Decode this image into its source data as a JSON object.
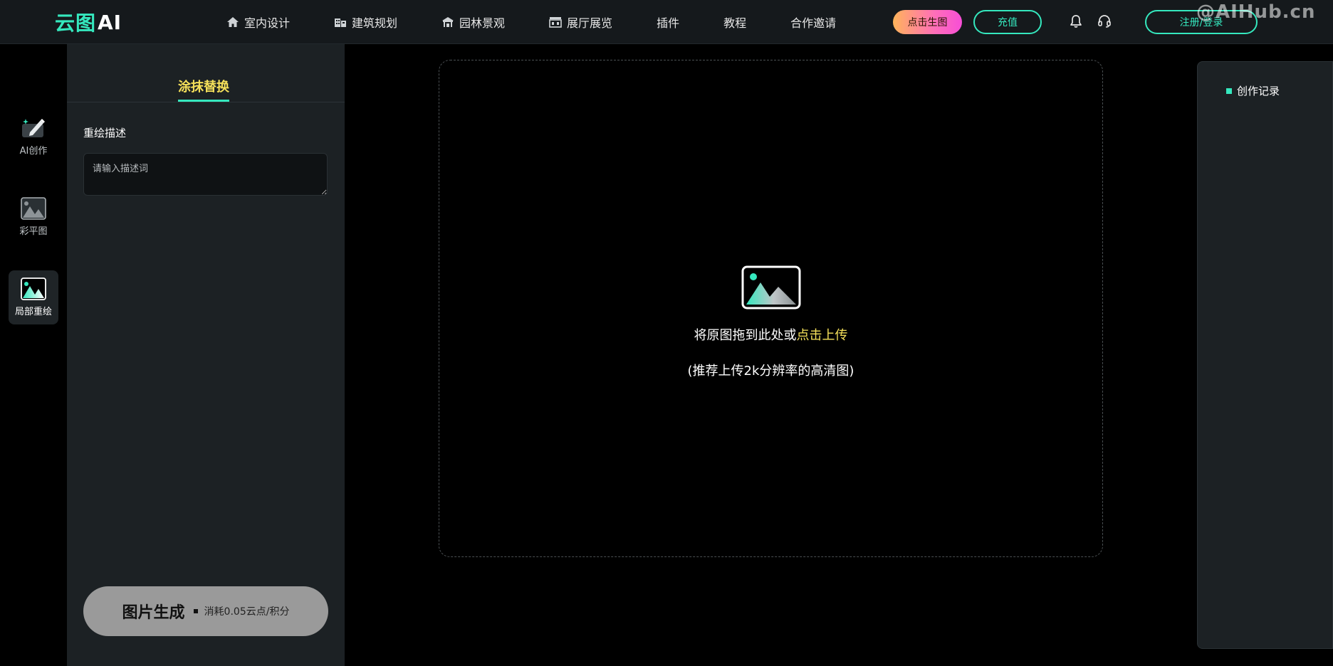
{
  "logo": {
    "cn": "云图",
    "ai": "AI"
  },
  "nav": {
    "items": [
      {
        "label": "室内设计",
        "icon": "home-icon"
      },
      {
        "label": "建筑规划",
        "icon": "building-icon"
      },
      {
        "label": "园林景观",
        "icon": "pavilion-icon"
      },
      {
        "label": "展厅展览",
        "icon": "exhibition-icon"
      },
      {
        "label": "插件",
        "icon": ""
      },
      {
        "label": "教程",
        "icon": ""
      },
      {
        "label": "合作邀请",
        "icon": ""
      }
    ],
    "generate_label": "点击生图",
    "recharge_label": "充值",
    "login_label": "注册/登录"
  },
  "watermark": "@AIHub.cn",
  "rail": {
    "items": [
      {
        "label": "AI创作",
        "icon": "magic-pen-icon",
        "active": false
      },
      {
        "label": "彩平图",
        "icon": "image-icon",
        "active": false
      },
      {
        "label": "局部重绘",
        "icon": "image-icon",
        "active": true
      }
    ]
  },
  "panel": {
    "tab": "涂抹替换",
    "field_label": "重绘描述",
    "field_placeholder": "请输入描述词",
    "field_value": "",
    "generate_main": "图片生成",
    "generate_cost": "消耗0.05云点/积分"
  },
  "upload": {
    "line1_prefix": "将原图拖到此处或",
    "line1_link": "点击上传",
    "line2": "(推荐上传2k分辨率的高清图)"
  },
  "history": {
    "title": "创作记录"
  },
  "colors": {
    "accent": "#35e8be",
    "highlight": "#f5e05a",
    "panel_bg": "#1c2124",
    "topbar_bg": "#15191c"
  }
}
